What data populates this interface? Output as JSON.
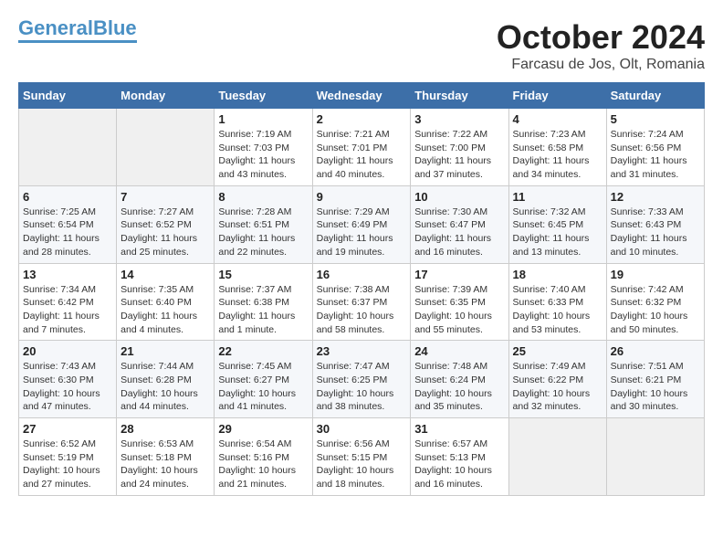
{
  "logo": {
    "general": "General",
    "blue": "Blue"
  },
  "title": "October 2024",
  "subtitle": "Farcasu de Jos, Olt, Romania",
  "days_of_week": [
    "Sunday",
    "Monday",
    "Tuesday",
    "Wednesday",
    "Thursday",
    "Friday",
    "Saturday"
  ],
  "weeks": [
    [
      {
        "num": "",
        "info": ""
      },
      {
        "num": "",
        "info": ""
      },
      {
        "num": "1",
        "info": "Sunrise: 7:19 AM\nSunset: 7:03 PM\nDaylight: 11 hours and 43 minutes."
      },
      {
        "num": "2",
        "info": "Sunrise: 7:21 AM\nSunset: 7:01 PM\nDaylight: 11 hours and 40 minutes."
      },
      {
        "num": "3",
        "info": "Sunrise: 7:22 AM\nSunset: 7:00 PM\nDaylight: 11 hours and 37 minutes."
      },
      {
        "num": "4",
        "info": "Sunrise: 7:23 AM\nSunset: 6:58 PM\nDaylight: 11 hours and 34 minutes."
      },
      {
        "num": "5",
        "info": "Sunrise: 7:24 AM\nSunset: 6:56 PM\nDaylight: 11 hours and 31 minutes."
      }
    ],
    [
      {
        "num": "6",
        "info": "Sunrise: 7:25 AM\nSunset: 6:54 PM\nDaylight: 11 hours and 28 minutes."
      },
      {
        "num": "7",
        "info": "Sunrise: 7:27 AM\nSunset: 6:52 PM\nDaylight: 11 hours and 25 minutes."
      },
      {
        "num": "8",
        "info": "Sunrise: 7:28 AM\nSunset: 6:51 PM\nDaylight: 11 hours and 22 minutes."
      },
      {
        "num": "9",
        "info": "Sunrise: 7:29 AM\nSunset: 6:49 PM\nDaylight: 11 hours and 19 minutes."
      },
      {
        "num": "10",
        "info": "Sunrise: 7:30 AM\nSunset: 6:47 PM\nDaylight: 11 hours and 16 minutes."
      },
      {
        "num": "11",
        "info": "Sunrise: 7:32 AM\nSunset: 6:45 PM\nDaylight: 11 hours and 13 minutes."
      },
      {
        "num": "12",
        "info": "Sunrise: 7:33 AM\nSunset: 6:43 PM\nDaylight: 11 hours and 10 minutes."
      }
    ],
    [
      {
        "num": "13",
        "info": "Sunrise: 7:34 AM\nSunset: 6:42 PM\nDaylight: 11 hours and 7 minutes."
      },
      {
        "num": "14",
        "info": "Sunrise: 7:35 AM\nSunset: 6:40 PM\nDaylight: 11 hours and 4 minutes."
      },
      {
        "num": "15",
        "info": "Sunrise: 7:37 AM\nSunset: 6:38 PM\nDaylight: 11 hours and 1 minute."
      },
      {
        "num": "16",
        "info": "Sunrise: 7:38 AM\nSunset: 6:37 PM\nDaylight: 10 hours and 58 minutes."
      },
      {
        "num": "17",
        "info": "Sunrise: 7:39 AM\nSunset: 6:35 PM\nDaylight: 10 hours and 55 minutes."
      },
      {
        "num": "18",
        "info": "Sunrise: 7:40 AM\nSunset: 6:33 PM\nDaylight: 10 hours and 53 minutes."
      },
      {
        "num": "19",
        "info": "Sunrise: 7:42 AM\nSunset: 6:32 PM\nDaylight: 10 hours and 50 minutes."
      }
    ],
    [
      {
        "num": "20",
        "info": "Sunrise: 7:43 AM\nSunset: 6:30 PM\nDaylight: 10 hours and 47 minutes."
      },
      {
        "num": "21",
        "info": "Sunrise: 7:44 AM\nSunset: 6:28 PM\nDaylight: 10 hours and 44 minutes."
      },
      {
        "num": "22",
        "info": "Sunrise: 7:45 AM\nSunset: 6:27 PM\nDaylight: 10 hours and 41 minutes."
      },
      {
        "num": "23",
        "info": "Sunrise: 7:47 AM\nSunset: 6:25 PM\nDaylight: 10 hours and 38 minutes."
      },
      {
        "num": "24",
        "info": "Sunrise: 7:48 AM\nSunset: 6:24 PM\nDaylight: 10 hours and 35 minutes."
      },
      {
        "num": "25",
        "info": "Sunrise: 7:49 AM\nSunset: 6:22 PM\nDaylight: 10 hours and 32 minutes."
      },
      {
        "num": "26",
        "info": "Sunrise: 7:51 AM\nSunset: 6:21 PM\nDaylight: 10 hours and 30 minutes."
      }
    ],
    [
      {
        "num": "27",
        "info": "Sunrise: 6:52 AM\nSunset: 5:19 PM\nDaylight: 10 hours and 27 minutes."
      },
      {
        "num": "28",
        "info": "Sunrise: 6:53 AM\nSunset: 5:18 PM\nDaylight: 10 hours and 24 minutes."
      },
      {
        "num": "29",
        "info": "Sunrise: 6:54 AM\nSunset: 5:16 PM\nDaylight: 10 hours and 21 minutes."
      },
      {
        "num": "30",
        "info": "Sunrise: 6:56 AM\nSunset: 5:15 PM\nDaylight: 10 hours and 18 minutes."
      },
      {
        "num": "31",
        "info": "Sunrise: 6:57 AM\nSunset: 5:13 PM\nDaylight: 10 hours and 16 minutes."
      },
      {
        "num": "",
        "info": ""
      },
      {
        "num": "",
        "info": ""
      }
    ]
  ]
}
